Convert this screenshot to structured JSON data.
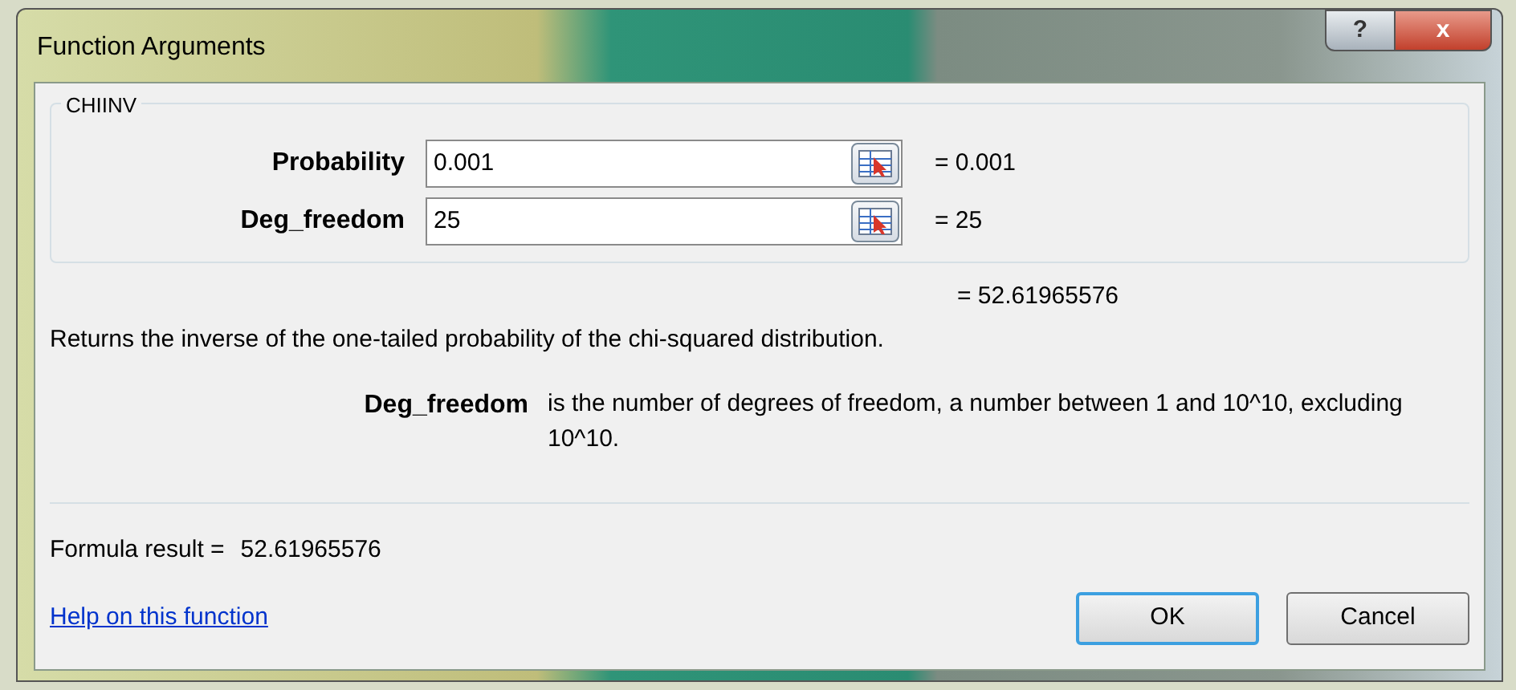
{
  "window": {
    "title": "Function Arguments",
    "help_button": "?",
    "close_button": "x"
  },
  "function_name": "CHIINV",
  "arguments": [
    {
      "label": "Probability",
      "value": "0.001",
      "result": "= 0.001"
    },
    {
      "label": "Deg_freedom",
      "value": "25",
      "result": "= 25"
    }
  ],
  "function_result": "= 52.61965576",
  "description": "Returns the inverse of the one-tailed probability of the chi-squared distribution.",
  "argument_help": {
    "label": "Deg_freedom",
    "text": "is the number of degrees of freedom, a number between 1 and 10^10, excluding 10^10."
  },
  "formula_result": {
    "label": "Formula result =",
    "value": "52.61965576"
  },
  "help_link": "Help on this function",
  "buttons": [
    {
      "label": "OK",
      "selected": true
    },
    {
      "label": "Cancel",
      "selected": false
    }
  ]
}
